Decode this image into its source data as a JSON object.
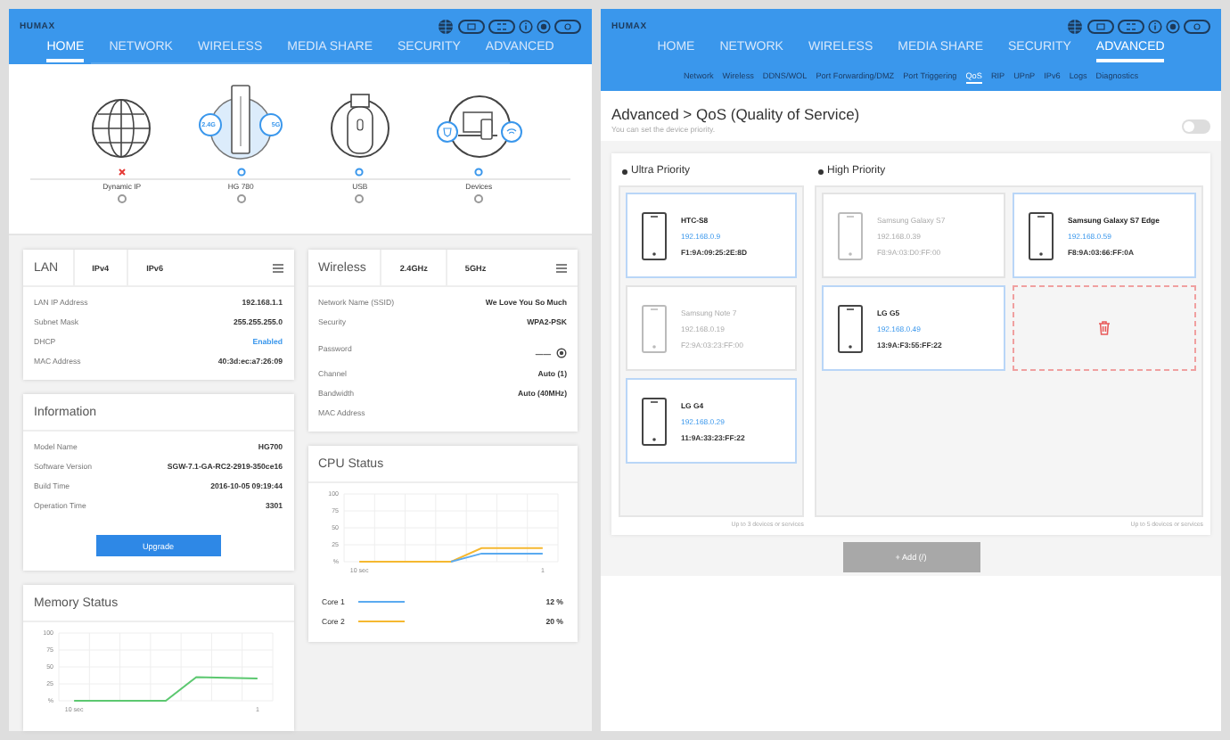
{
  "home_page": {
    "header": {
      "logo": "HUMAX",
      "nav": [
        {
          "label": "HOME",
          "selected": true
        },
        {
          "label": "NETWORK",
          "selected": false
        },
        {
          "label": "WIRELESS",
          "selected": false
        },
        {
          "label": "MEDIA SHARE",
          "selected": false
        },
        {
          "label": "SECURITY",
          "selected": false
        },
        {
          "label": "ADVANCED",
          "selected": false
        }
      ]
    },
    "diagram": [
      {
        "kind": "globe",
        "label": "Dynamic IP",
        "connected": false,
        "selected": false
      },
      {
        "kind": "router",
        "label": "HG 780",
        "connected": true,
        "selected": false,
        "badges": [
          "2.4G",
          "5G"
        ]
      },
      {
        "kind": "usb",
        "label": "USB",
        "connected": true,
        "selected": false
      },
      {
        "kind": "devices",
        "label": "Devices",
        "connected": true,
        "selected": false
      }
    ],
    "lan_card": {
      "title": "LAN",
      "tabs": [
        "IPv4",
        "IPv6"
      ],
      "rows": [
        {
          "kind": "text",
          "label": "LAN IP Address",
          "value": "192.168.1.1"
        },
        {
          "kind": "text",
          "label": "Subnet Mask",
          "value": "255.255.255.0"
        },
        {
          "kind": "link",
          "label": "DHCP",
          "value": "Enabled"
        },
        {
          "kind": "text",
          "label": "MAC Address",
          "value": "40:3d:ec:a7:26:09"
        }
      ]
    },
    "information_card": {
      "title": "Information",
      "rows": [
        {
          "kind": "text",
          "label": "Model Name",
          "value": "HG700"
        },
        {
          "kind": "text",
          "label": "Software Version",
          "value": "SGW-7.1-GA-RC2-2919-350ce16"
        },
        {
          "kind": "text",
          "label": "Build Time",
          "value": "2016-10-05 09:19:44"
        },
        {
          "kind": "text",
          "label": "Operation Time",
          "value": "3301"
        }
      ],
      "button": "Upgrade"
    },
    "memory_card": {
      "title": "Memory Status",
      "chart_data": {
        "type": "line",
        "grid": true,
        "categories": [
          "10 sec",
          null,
          null,
          null,
          null,
          null,
          "1"
        ],
        "ylabel": "%",
        "ylim": [
          0,
          100
        ],
        "yticks": [
          25,
          50,
          75,
          100
        ],
        "series": [
          {
            "color": "#5cc870",
            "values": [
              0,
              0,
              0,
              0,
              35,
              34,
              33
            ]
          }
        ]
      }
    },
    "wireless_card": {
      "title": "Wireless",
      "tabs": [
        "2.4GHz",
        "5GHz"
      ],
      "rows": [
        {
          "kind": "text",
          "label": "Network Name (SSID)",
          "value": "We Love You So Much"
        },
        {
          "kind": "text",
          "label": "Security",
          "value": "WPA2-PSK"
        },
        {
          "kind": "password",
          "label": "Password",
          "value": "——"
        },
        {
          "kind": "text",
          "label": "Channel",
          "value": "Auto (1)"
        },
        {
          "kind": "text",
          "label": "Bandwidth",
          "value": "Auto (40MHz)"
        },
        {
          "kind": "text",
          "label": "MAC Address"
        }
      ]
    },
    "cpu_card": {
      "title": "CPU Status",
      "chart_data": {
        "type": "line",
        "grid": true,
        "categories": [
          "10 sec",
          null,
          null,
          null,
          null,
          null,
          "1"
        ],
        "ylabel": "%",
        "ylim": [
          0,
          100
        ],
        "yticks": [
          25,
          50,
          75,
          100
        ],
        "series": [
          {
            "name": "Core 1",
            "color": "#5aaaf0",
            "values": [
              null,
              null,
              null,
              0,
              12,
              12,
              12
            ]
          },
          {
            "name": "Core 2",
            "color": "#f5b830",
            "values": [
              0,
              0,
              0,
              0,
              20,
              20,
              20
            ]
          }
        ]
      },
      "legend_values": [
        "12 %",
        "20 %"
      ]
    }
  },
  "qos_page": {
    "header": {
      "logo": "HUMAX",
      "nav": [
        {
          "label": "HOME",
          "selected": false
        },
        {
          "label": "NETWORK",
          "selected": false
        },
        {
          "label": "WIRELESS",
          "selected": false
        },
        {
          "label": "MEDIA SHARE",
          "selected": false
        },
        {
          "label": "SECURITY",
          "selected": false
        },
        {
          "label": "ADVANCED",
          "selected": true
        }
      ],
      "subnav": [
        {
          "label": "Network",
          "selected": false
        },
        {
          "label": "Wireless",
          "selected": false
        },
        {
          "label": "DDNS/WOL",
          "selected": false
        },
        {
          "label": "Port Forwarding/DMZ",
          "selected": false
        },
        {
          "label": "Port Triggering",
          "selected": false
        },
        {
          "label": "QoS",
          "selected": true
        },
        {
          "label": "RIP",
          "selected": false
        },
        {
          "label": "UPnP",
          "selected": false
        },
        {
          "label": "IPv6",
          "selected": false
        },
        {
          "label": "Logs",
          "selected": false
        },
        {
          "label": "Diagnostics",
          "selected": false
        }
      ]
    },
    "title": "Advanced > QoS (Quality of Service)",
    "subtitle": "You can set the device priority.",
    "toggle": {
      "on": false
    },
    "columns": [
      {
        "title": "Ultra Priority",
        "drop_zone": false,
        "note": "Up to 3 devices or services",
        "devices": [
          {
            "name": "HTC-S8",
            "ip": "192.168.0.9",
            "mac": "F1:9A:09:25:2E:8D",
            "active": true
          },
          {
            "name": "Samsung Note 7",
            "ip": "192.168.0.19",
            "mac": "F2:9A:03:23:FF:00",
            "active": false
          },
          {
            "name": "LG G4",
            "ip": "192.168.0.29",
            "mac": "11:9A:33:23:FF:22",
            "active": true
          }
        ]
      },
      {
        "title": "High Priority",
        "drop_zone": true,
        "note": "Up to 5 devices or services",
        "devices": [
          {
            "name": "Samsung Galaxy S7",
            "ip": "192.168.0.39",
            "mac": "F8:9A:03:D0:FF:00",
            "active": false
          },
          {
            "name": "Samsung Galaxy S7 Edge",
            "ip": "192.168.0.59",
            "mac": "F8:9A:03:66:FF:0A",
            "active": true
          },
          {
            "name": "LG G5",
            "ip": "192.168.0.49",
            "mac": "13:9A:F3:55:FF:22",
            "active": true
          }
        ]
      }
    ],
    "add_button": "+ Add (/)"
  }
}
